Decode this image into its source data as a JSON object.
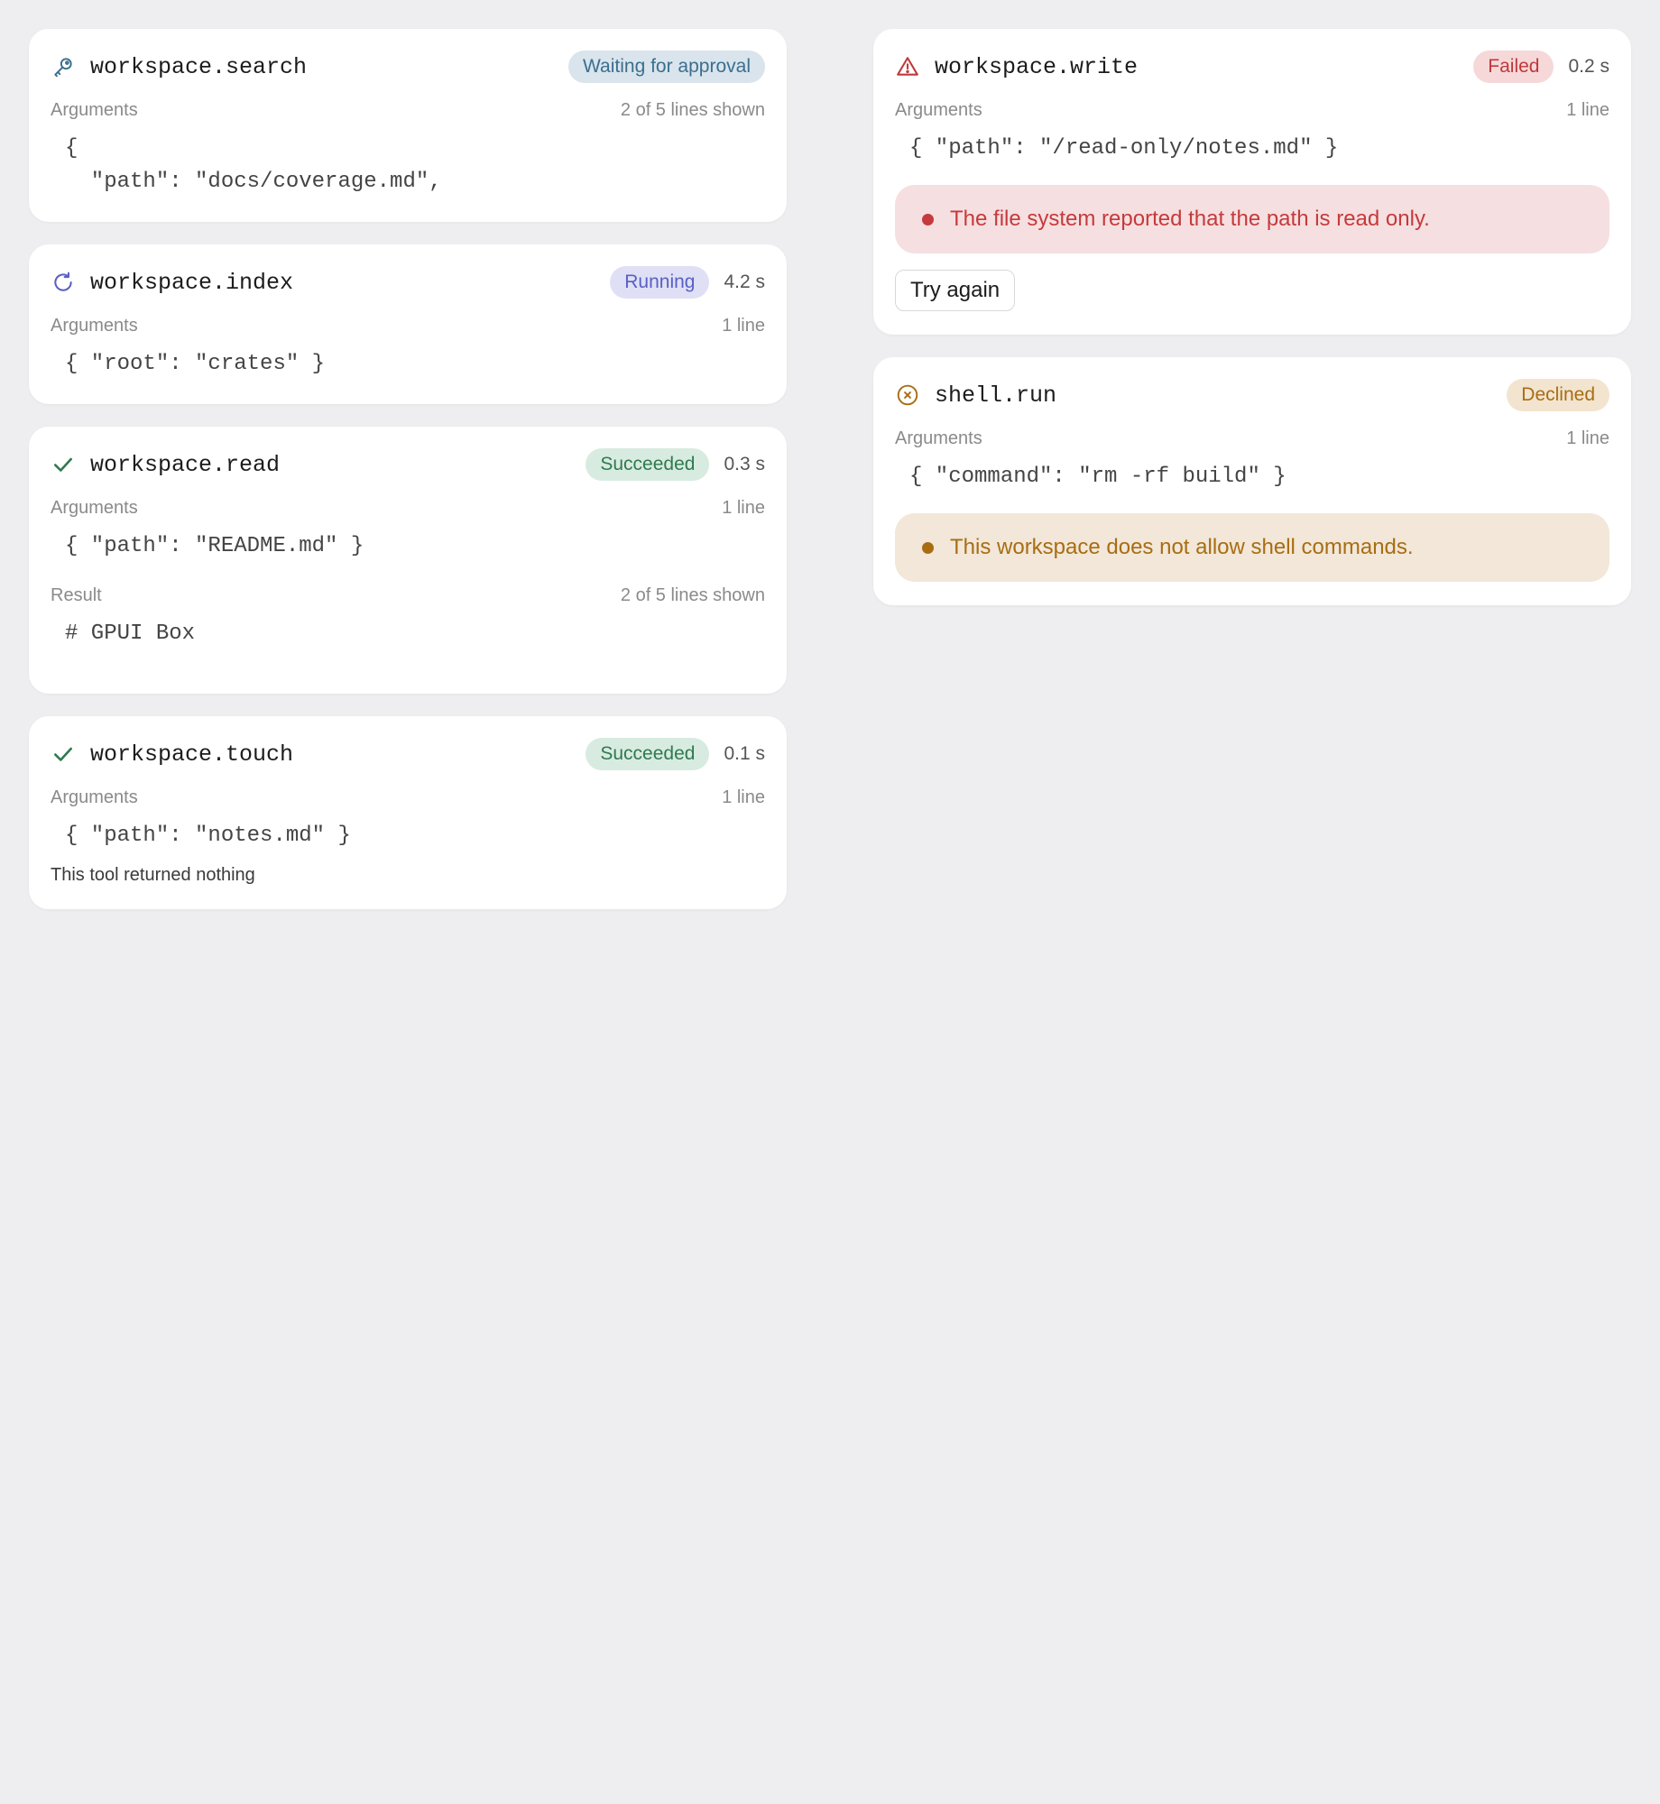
{
  "colors": {
    "background": "#eeeef0",
    "card": "#ffffff",
    "waiting": "#3b6f8e",
    "running": "#5a5fc4",
    "success": "#2f7a4f",
    "failed": "#c0383b",
    "declined": "#a86d13"
  },
  "cards": {
    "search": {
      "icon": "key-icon",
      "name": "workspace.search",
      "status": "Waiting for approval",
      "args_label": "Arguments",
      "args_meta": "2 of 5 lines shown",
      "args_code": "{\n  \"path\": \"docs/coverage.md\","
    },
    "index": {
      "icon": "refresh-icon",
      "name": "workspace.index",
      "status": "Running",
      "duration": "4.2 s",
      "args_label": "Arguments",
      "args_meta": "1 line",
      "args_code": "{ \"root\": \"crates\" }"
    },
    "read": {
      "icon": "check-icon",
      "name": "workspace.read",
      "status": "Succeeded",
      "duration": "0.3 s",
      "args_label": "Arguments",
      "args_meta": "1 line",
      "args_code": "{ \"path\": \"README.md\" }",
      "result_label": "Result",
      "result_meta": "2 of 5 lines shown",
      "result_code": "# GPUI Box"
    },
    "touch": {
      "icon": "check-icon",
      "name": "workspace.touch",
      "status": "Succeeded",
      "duration": "0.1 s",
      "args_label": "Arguments",
      "args_meta": "1 line",
      "args_code": "{ \"path\": \"notes.md\" }",
      "note": "This tool returned nothing"
    },
    "write": {
      "icon": "warning-icon",
      "name": "workspace.write",
      "status": "Failed",
      "duration": "0.2 s",
      "args_label": "Arguments",
      "args_meta": "1 line",
      "args_code": "{ \"path\": \"/read-only/notes.md\" }",
      "alert": "The file system reported that the path is read only.",
      "retry_label": "Try again"
    },
    "shell": {
      "icon": "x-circle-icon",
      "name": "shell.run",
      "status": "Declined",
      "args_label": "Arguments",
      "args_meta": "1 line",
      "args_code": "{ \"command\": \"rm -rf build\" }",
      "alert": "This workspace does not allow shell commands."
    }
  }
}
